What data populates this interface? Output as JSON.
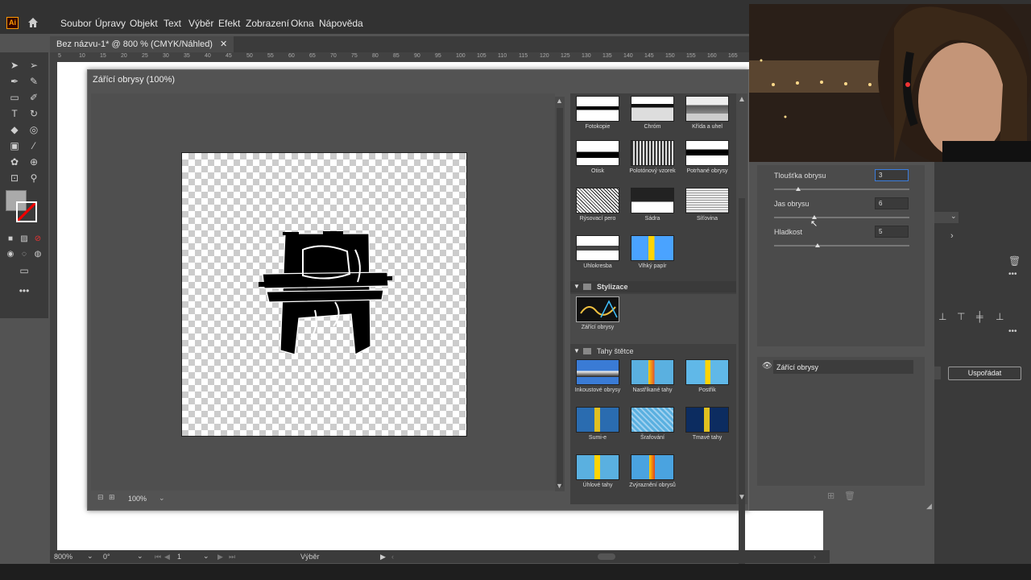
{
  "app": {
    "logo_text": "Ai"
  },
  "menu": [
    "Soubor",
    "Úpravy",
    "Objekt",
    "Text",
    "Výběr",
    "Efekt",
    "Zobrazení",
    "Okna",
    "Nápověda"
  ],
  "document_tab": {
    "title": "Bez názvu-1* @ 800 % (CMYK/Náhled)",
    "close": "✕"
  },
  "ruler_ticks": [
    "5",
    "10",
    "15",
    "20",
    "25",
    "30",
    "35",
    "40",
    "45",
    "50",
    "55",
    "60",
    "65",
    "70",
    "75",
    "80",
    "85",
    "90",
    "95",
    "100",
    "105",
    "110",
    "115",
    "120",
    "125",
    "130",
    "135",
    "140",
    "145",
    "150",
    "155",
    "160",
    "165"
  ],
  "dialog": {
    "title": "Zářící obrysy (100%)",
    "zoom": "100%"
  },
  "gallery": {
    "row1": [
      "Fotokopie",
      "Chróm",
      "Křída a uhel"
    ],
    "row2": [
      "Otisk",
      "Polotónový vzorek",
      "Potrhané obrysy"
    ],
    "row3": [
      "Rýsovací pero",
      "Sádra",
      "Síťovina"
    ],
    "row4": [
      "Uhlokresba",
      "Vlhký papír"
    ],
    "section_stylize": "Stylizace",
    "stylize_items": [
      "Zářící obrysy"
    ],
    "section_brush": "Tahy štětce",
    "brush_row1": [
      "Inkoustové obrysy",
      "Nastříkané tahy",
      "Postřik"
    ],
    "brush_row2": [
      "Sumi-e",
      "Šrafování",
      "Tmavé tahy"
    ],
    "brush_row3": [
      "Úhlové tahy",
      "Zvýraznění obrysů"
    ]
  },
  "settings": {
    "params": [
      {
        "label": "Tloušťka obrysu",
        "value": "3",
        "level": 0.18
      },
      {
        "label": "Jas obrysu",
        "value": "6",
        "level": 0.3
      },
      {
        "label": "Hladkost",
        "value": "5",
        "level": 0.32
      }
    ]
  },
  "layers": {
    "effect_name": "Zářící obrysy"
  },
  "right_panel": {
    "arrange_button": "Uspořádat"
  },
  "statusbar": {
    "zoom": "800%",
    "rotation": "0°",
    "artboard": "1",
    "tool": "Výběr"
  },
  "colors": {
    "accent": "#ff9a00",
    "dialog_bg": "#535353",
    "panel_bg": "#404040"
  }
}
